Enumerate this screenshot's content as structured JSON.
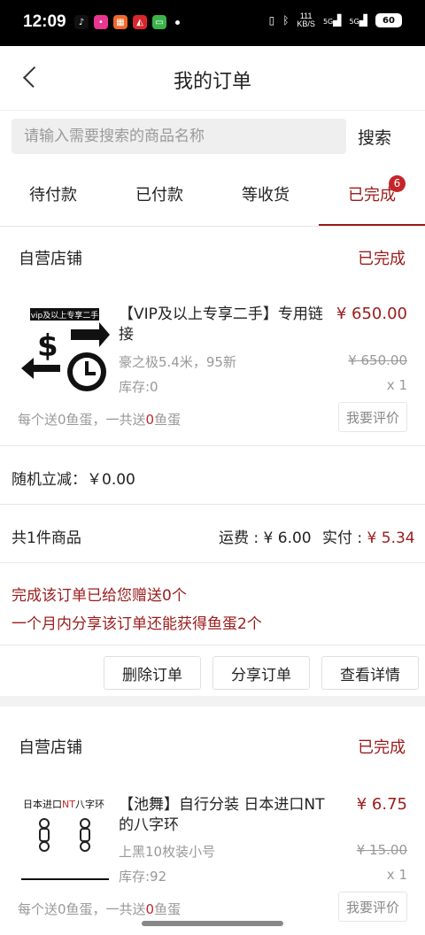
{
  "statusbar": {
    "time": "12:09",
    "net_speed_value": "111",
    "net_speed_unit": "KB/S",
    "sig1": "5G",
    "sig2": "5G",
    "battery": "60"
  },
  "header": {
    "title": "我的订单"
  },
  "search": {
    "placeholder": "请输入需要搜索的商品名称",
    "button": "搜索"
  },
  "tabs": [
    {
      "label": "待付款"
    },
    {
      "label": "已付款"
    },
    {
      "label": "等收货"
    },
    {
      "label": "已完成",
      "badge": "6"
    }
  ],
  "orders": [
    {
      "shop": "自营店铺",
      "status": "已完成",
      "thumb_text": "vip及以上专享二手",
      "product_name": "【VIP及以上专享二手】专用链接",
      "price": "¥ 650.00",
      "spec": "豪之极5.4米，95新",
      "original_price": "¥ 650.00",
      "stock": "库存:0",
      "qty": "x 1",
      "gift_prefix": "每个送0鱼蛋，一共送",
      "gift_count": "0",
      "gift_suffix": "鱼蛋",
      "rate_button": "我要评价",
      "discount_label": "随机立减：",
      "discount_value": "￥0.00",
      "item_count": "共1件商品",
      "shipping": "运费 : ¥ 6.00",
      "paid_label": "实付 : ",
      "paid_value": "¥ 5.34",
      "promo_line1": "完成该订单已给您赠送0个",
      "promo_line2": "一个月内分享该订单还能获得鱼蛋2个",
      "actions": [
        "删除订单",
        "分享订单",
        "查看详情"
      ]
    },
    {
      "shop": "自营店铺",
      "status": "已完成",
      "thumb_text_a": "日本进口",
      "thumb_text_b": "NT",
      "thumb_text_c": "八字环",
      "product_name": "【池舞】自行分装 日本进口NT的八字环",
      "price": "¥ 6.75",
      "spec": "上黑10枚装小号",
      "original_price": "¥ 15.00",
      "stock": "库存:92",
      "qty": "x 1",
      "gift_prefix": "每个送0鱼蛋，一共送",
      "gift_count": "0",
      "gift_suffix": "鱼蛋",
      "rate_button": "我要评价"
    }
  ]
}
